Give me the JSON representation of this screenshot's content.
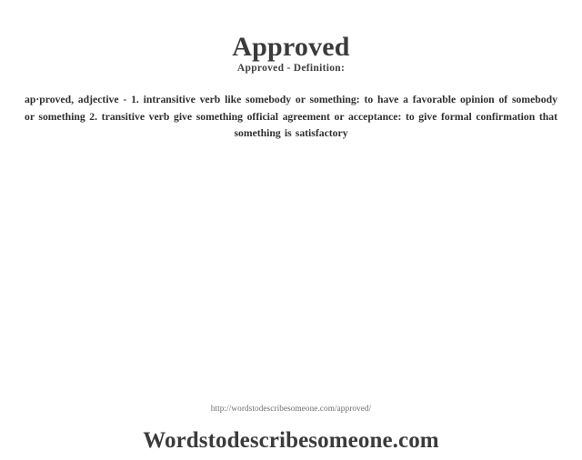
{
  "document": {
    "title": "Approved",
    "subtitle": "Approved - Definition:",
    "definition": "ap·proved, adjective - 1. intransitive verb like somebody  or something:  to have a favorable  opinion  of somebody   or something   2. transitive verb give  something official  agreement   or acceptance:  to give  formal  confirmation  that something   is satisfactory",
    "footer": {
      "url": "http://wordstodescribesomeone.com/approved/",
      "brand": "Wordstodescribesomeone.com"
    }
  },
  "colors": {
    "background": "#ffffff",
    "heading": "#3b3b3b",
    "body_text": "#2f2f2f",
    "muted_text": "#6d6d6d"
  }
}
